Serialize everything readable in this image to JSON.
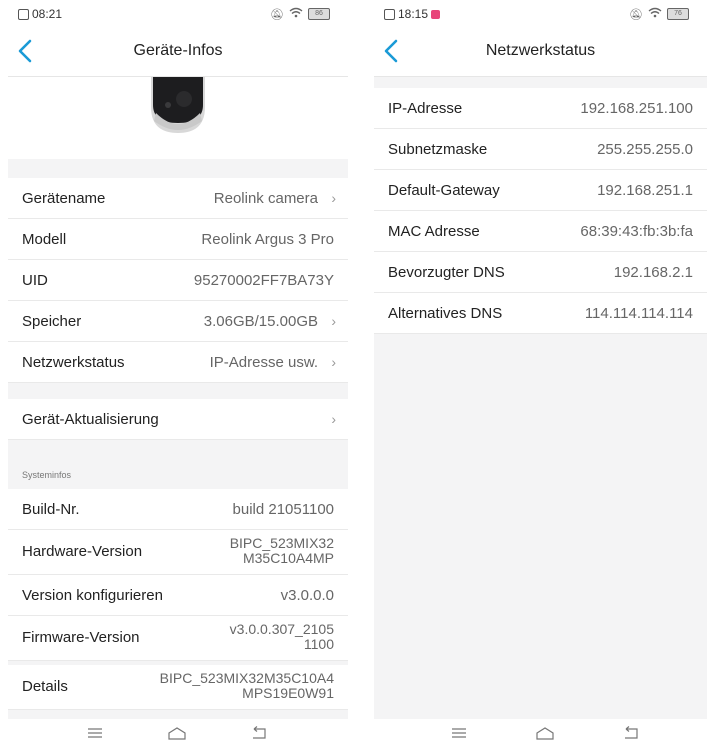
{
  "left": {
    "status": {
      "time": "08:21",
      "battery": "86"
    },
    "title": "Geräte-Infos",
    "rows": [
      {
        "label": "Gerätename",
        "value": "Reolink camera"
      },
      {
        "label": "Modell",
        "value": "Reolink Argus 3 Pro"
      },
      {
        "label": "UID",
        "value": "95270002FF7BA73Y"
      },
      {
        "label": "Speicher",
        "value": "3.06GB/15.00GB"
      },
      {
        "label": "Netzwerkstatus",
        "value": "IP-Adresse usw."
      }
    ],
    "update_label": "Gerät-Aktualisierung",
    "section_title": "Systeminfos",
    "sys_rows": [
      {
        "label": "Build-Nr.",
        "value": "build 21051100"
      },
      {
        "label": "Hardware-Version",
        "value_line1": "BIPC_523MIX32",
        "value_line2": "M35C10A4MP"
      },
      {
        "label": "Version konfigurieren",
        "value": "v3.0.0.0"
      },
      {
        "label": "Firmware-Version",
        "value_line1": "v3.0.0.307_2105",
        "value_line2": "1100"
      },
      {
        "label": "Details",
        "value_line1": "BIPC_523MIX32M35C10A4",
        "value_line2": "MPS19E0W91"
      }
    ]
  },
  "right": {
    "status": {
      "time": "18:15",
      "battery": "76"
    },
    "title": "Netzwerkstatus",
    "rows": [
      {
        "label": "IP-Adresse",
        "value": "192.168.251.100"
      },
      {
        "label": "Subnetzmaske",
        "value": "255.255.255.0"
      },
      {
        "label": "Default-Gateway",
        "value": "192.168.251.1"
      },
      {
        "label": "MAC Adresse",
        "value": "68:39:43:fb:3b:fa"
      },
      {
        "label": "Bevorzugter DNS",
        "value": "192.168.2.1"
      },
      {
        "label": "Alternatives DNS",
        "value": "114.114.114.114"
      }
    ]
  },
  "colors": {
    "accent": "#1a9ad6",
    "background": "#f4f4f5"
  }
}
